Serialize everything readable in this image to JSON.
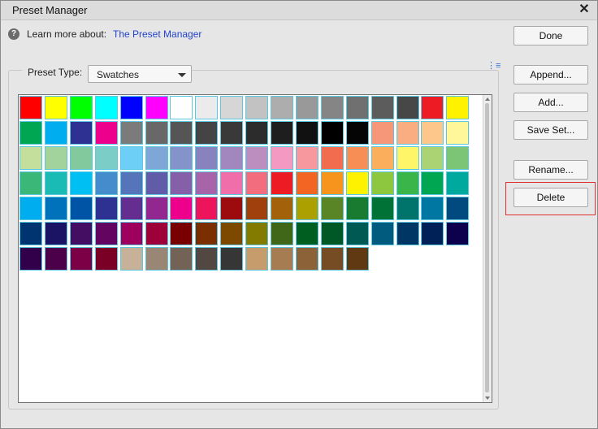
{
  "window": {
    "title": "Preset Manager",
    "close_glyph": "✕"
  },
  "help": {
    "icon": "help-icon",
    "label": "Learn more about:",
    "link": "The Preset Manager"
  },
  "preset_type": {
    "label": "Preset Type:",
    "value": "Swatches"
  },
  "menu_icon": "list-menu-icon",
  "buttons": {
    "done": "Done",
    "append": "Append...",
    "add": "Add...",
    "save_set": "Save Set...",
    "rename": "Rename...",
    "delete": "Delete"
  },
  "swatches": [
    [
      "#ff0000",
      "#ffff00",
      "#00ff00",
      "#00ffff",
      "#0000ff",
      "#ff00ff",
      "#ffffff",
      "#ebebeb",
      "#d6d6d6",
      "#c2c2c2",
      "#adadad",
      "#999999",
      "#858585",
      "#707070",
      "#5c5c5c",
      "#474747",
      "#ed1c24",
      "#fff200"
    ],
    [
      "#00a651",
      "#00aeef",
      "#2e3192",
      "#ec008c",
      "#7b7b7b",
      "#686868",
      "#555555",
      "#444444",
      "#393939",
      "#2c2c2c",
      "#1e1e1e",
      "#111111",
      "#000000",
      "#050505",
      "#f7977a",
      "#f9ad81",
      "#fdc68a",
      "#fff79a"
    ],
    [
      "#c4df9b",
      "#a2d39c",
      "#82ca9d",
      "#7bcdc8",
      "#6ecff6",
      "#7ea7d8",
      "#8493ca",
      "#8882be",
      "#a187be",
      "#bc8dbf",
      "#f49ac2",
      "#f6989d",
      "#f26c4f",
      "#f68e56",
      "#fbaf5d",
      "#fff568",
      "#acd373",
      "#7cc576"
    ],
    [
      "#3bb878",
      "#1abbb4",
      "#00bff3",
      "#448ccb",
      "#5574b9",
      "#605ca8",
      "#8560a8",
      "#a864a8",
      "#f06eaa",
      "#f26d7d",
      "#ed1c24",
      "#f26522",
      "#f7941d",
      "#fff200",
      "#8dc63f",
      "#39b54a",
      "#00a651",
      "#00a99d"
    ],
    [
      "#00aeef",
      "#0072bc",
      "#0054a6",
      "#2e3192",
      "#662d91",
      "#92278f",
      "#ec008c",
      "#ed145b",
      "#9e0b0f",
      "#a0410d",
      "#a3620a",
      "#aba000",
      "#598527",
      "#197b30",
      "#007236",
      "#00746b",
      "#0076a3",
      "#004a80"
    ],
    [
      "#003471",
      "#1b1464",
      "#440e62",
      "#630460",
      "#9e005d",
      "#9e0039",
      "#790000",
      "#7b2e00",
      "#7d4900",
      "#827b00",
      "#406618",
      "#005e20",
      "#005826",
      "#005952",
      "#005b7f",
      "#003663",
      "#002157",
      "#0d004c"
    ],
    [
      "#32004b",
      "#4b0049",
      "#7b0046",
      "#7a0026",
      "#c7b299",
      "#998675",
      "#736357",
      "#534741",
      "#363636",
      "#c69c6d",
      "#a67c52",
      "#8c6239",
      "#754c24",
      "#603913"
    ]
  ]
}
